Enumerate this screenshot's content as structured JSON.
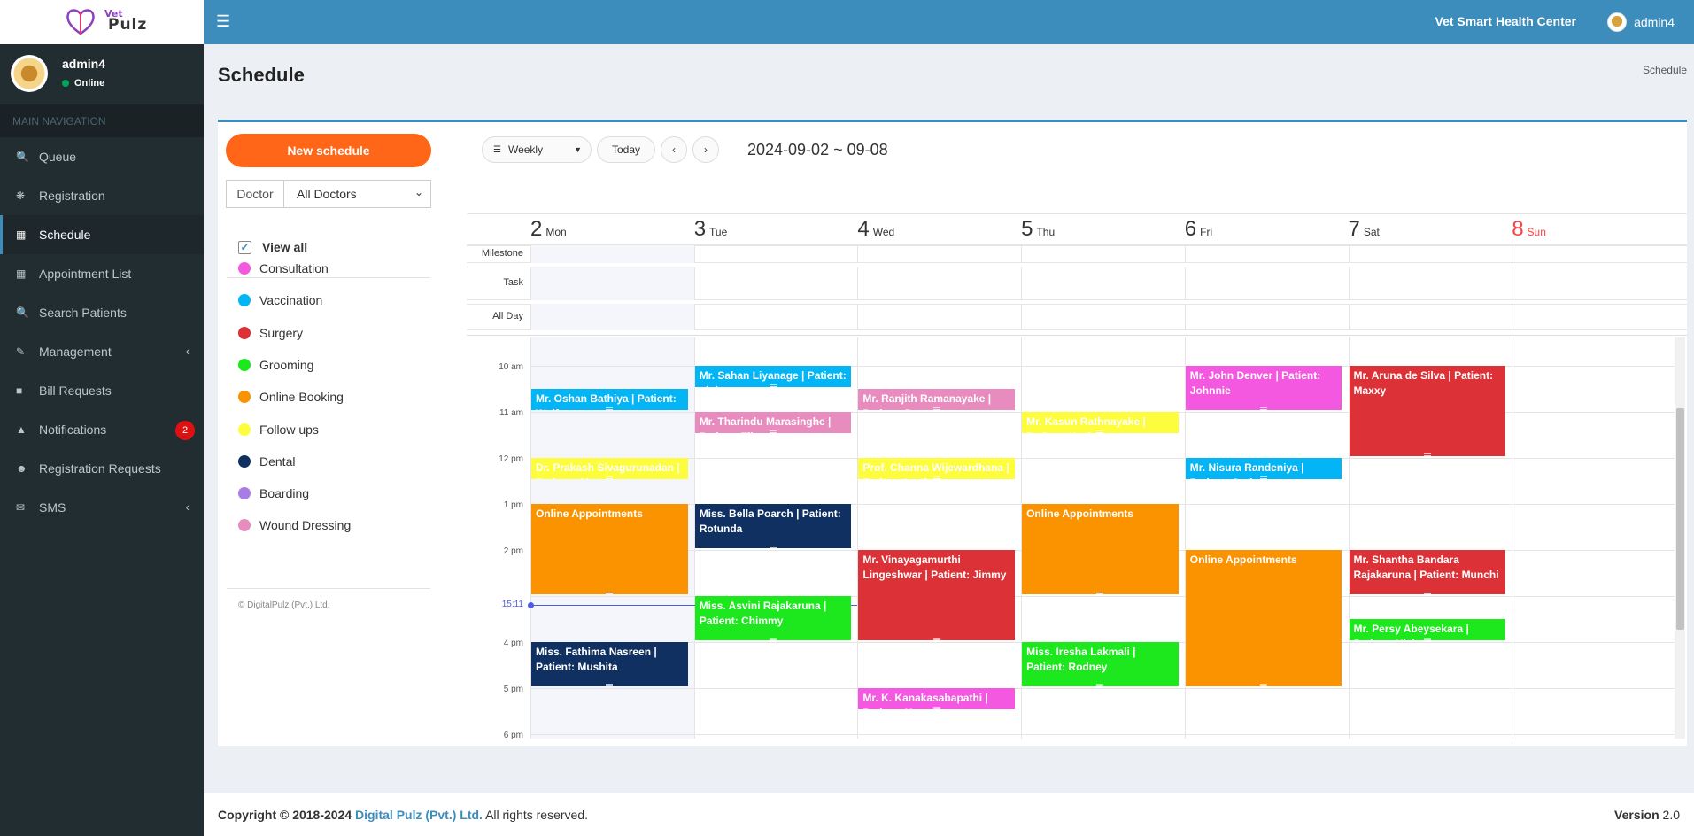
{
  "brand": {
    "logo_line1": "Vet",
    "logo_line2": "Pulz"
  },
  "topbar": {
    "center_name": "Vet Smart Health Center",
    "user": "admin4"
  },
  "user_panel": {
    "name": "admin4",
    "status": "Online"
  },
  "nav": {
    "header": "MAIN NAVIGATION",
    "items": [
      {
        "label": "Queue",
        "icon": "search-icon"
      },
      {
        "label": "Registration",
        "icon": "paw-icon"
      },
      {
        "label": "Schedule",
        "icon": "calendar-icon",
        "active": true
      },
      {
        "label": "Appointment List",
        "icon": "calendar-icon"
      },
      {
        "label": "Search Patients",
        "icon": "search-icon"
      },
      {
        "label": "Management",
        "icon": "edit-icon"
      },
      {
        "label": "Bill Requests",
        "icon": "folder-icon"
      },
      {
        "label": "Notifications",
        "icon": "bell-icon",
        "badge": "2"
      },
      {
        "label": "Registration Requests",
        "icon": "user-plus-icon"
      },
      {
        "label": "SMS",
        "icon": "envelope-icon"
      }
    ]
  },
  "page": {
    "title": "Schedule",
    "breadcrumb": "Schedule"
  },
  "left_panel": {
    "new_button": "New schedule",
    "doctor_label": "Doctor",
    "doctor_select": "All Doctors",
    "view_all": "View all",
    "categories": [
      {
        "label": "Consultation",
        "color": "#f558e0"
      },
      {
        "label": "Vaccination",
        "color": "#03b5f4"
      },
      {
        "label": "Surgery",
        "color": "#dc3237"
      },
      {
        "label": "Grooming",
        "color": "#1de81d"
      },
      {
        "label": "Online Booking",
        "color": "#fb9300"
      },
      {
        "label": "Follow ups",
        "color": "#fdfd3d"
      },
      {
        "label": "Dental",
        "color": "#0f3060"
      },
      {
        "label": "Boarding",
        "color": "#a97be6"
      },
      {
        "label": "Wound Dressing",
        "color": "#e88bbf"
      }
    ],
    "copyright": "© DigitalPulz (Pvt.) Ltd."
  },
  "toolbar": {
    "view": "Weekly",
    "today": "Today",
    "range": "2024-09-02 ~ 09-08"
  },
  "calendar": {
    "days": [
      {
        "num": "2",
        "name": "Mon"
      },
      {
        "num": "3",
        "name": "Tue"
      },
      {
        "num": "4",
        "name": "Wed"
      },
      {
        "num": "5",
        "name": "Thu"
      },
      {
        "num": "6",
        "name": "Fri"
      },
      {
        "num": "7",
        "name": "Sat"
      },
      {
        "num": "8",
        "name": "Sun"
      }
    ],
    "row_labels": {
      "milestone": "Milestone",
      "task": "Task",
      "allday": "All Day"
    },
    "hours": [
      "10 am",
      "11 am",
      "12 pm",
      "1 pm",
      "2 pm",
      "4 pm",
      "5 pm",
      "6 pm"
    ],
    "now": "15:11",
    "events": [
      {
        "day": 1,
        "start": 10.0,
        "end": 10.5,
        "color": "#03b5f4",
        "text": "Mr. Sahan Liyanage | Patient: pinky"
      },
      {
        "day": 4,
        "start": 10.0,
        "end": 11.0,
        "color": "#f558e0",
        "text": "Mr. John Denver | Patient: Johnnie"
      },
      {
        "day": 5,
        "start": 10.0,
        "end": 12.0,
        "color": "#dc3237",
        "text": "Mr. Aruna de Silva | Patient: Maxxy"
      },
      {
        "day": 0,
        "start": 10.5,
        "end": 11.0,
        "color": "#03b5f4",
        "text": "Mr. Oshan Bathiya | Patient: Wolfy"
      },
      {
        "day": 2,
        "start": 10.5,
        "end": 11.0,
        "color": "#e88bbf",
        "text": "Mr. Ranjith Ramanayake | Patient: Dawy"
      },
      {
        "day": 1,
        "start": 11.0,
        "end": 11.5,
        "color": "#e88bbf",
        "text": "Mr. Tharindu Marasinghe | Patient: Tiles"
      },
      {
        "day": 3,
        "start": 11.0,
        "end": 11.5,
        "color": "#fdfd3d",
        "text": "Mr. Kasun Rathnayake | Patient: Kevin"
      },
      {
        "day": 0,
        "start": 12.0,
        "end": 12.5,
        "color": "#fdfd3d",
        "text": "Dr. Prakash Sivagurunadan | Patient: Ginger"
      },
      {
        "day": 2,
        "start": 12.0,
        "end": 12.5,
        "color": "#fdfd3d",
        "text": "Prof. Channa Wijewardhana | Patient: Lucky"
      },
      {
        "day": 4,
        "start": 12.0,
        "end": 12.5,
        "color": "#03b5f4",
        "text": "Mr. Nisura Randeniya | Patient: Jack"
      },
      {
        "day": 0,
        "start": 13.0,
        "end": 15.0,
        "color": "#fb9300",
        "text": "Online Appointments"
      },
      {
        "day": 1,
        "start": 13.0,
        "end": 14.0,
        "color": "#0f3060",
        "text": "Miss. Bella Poarch | Patient: Rotunda"
      },
      {
        "day": 3,
        "start": 13.0,
        "end": 15.0,
        "color": "#fb9300",
        "text": "Online Appointments"
      },
      {
        "day": 2,
        "start": 14.0,
        "end": 16.0,
        "color": "#dc3237",
        "text": "Mr. Vinayagamurthi Lingeshwar | Patient: Jimmy"
      },
      {
        "day": 4,
        "start": 14.0,
        "end": 17.0,
        "color": "#fb9300",
        "text": "Online Appointments"
      },
      {
        "day": 5,
        "start": 14.0,
        "end": 15.0,
        "color": "#dc3237",
        "text": "Mr. Shantha Bandara Rajakaruna | Patient: Munchi"
      },
      {
        "day": 1,
        "start": 15.0,
        "end": 16.0,
        "color": "#1de81d",
        "text": "Miss. Asvini Rajakaruna | Patient: Chimmy"
      },
      {
        "day": 5,
        "start": 15.5,
        "end": 16.0,
        "color": "#1de81d",
        "text": "Mr. Persy Abeysekara | Patient: Nicky"
      },
      {
        "day": 0,
        "start": 16.0,
        "end": 17.0,
        "color": "#0f3060",
        "text": "Miss. Fathima Nasreen | Patient: Mushita"
      },
      {
        "day": 3,
        "start": 16.0,
        "end": 17.0,
        "color": "#1de81d",
        "text": "Miss. Iresha Lakmali | Patient: Rodney"
      },
      {
        "day": 2,
        "start": 17.0,
        "end": 17.5,
        "color": "#f558e0",
        "text": "Mr. K. Kanakasabapathi | Patient: Hew"
      }
    ]
  },
  "footer": {
    "copyright_prefix": "Copyright © 2018-2024",
    "company": "Digital Pulz (Pvt.) Ltd.",
    "rights": "All rights reserved.",
    "version_label": "Version",
    "version": "2.0"
  }
}
